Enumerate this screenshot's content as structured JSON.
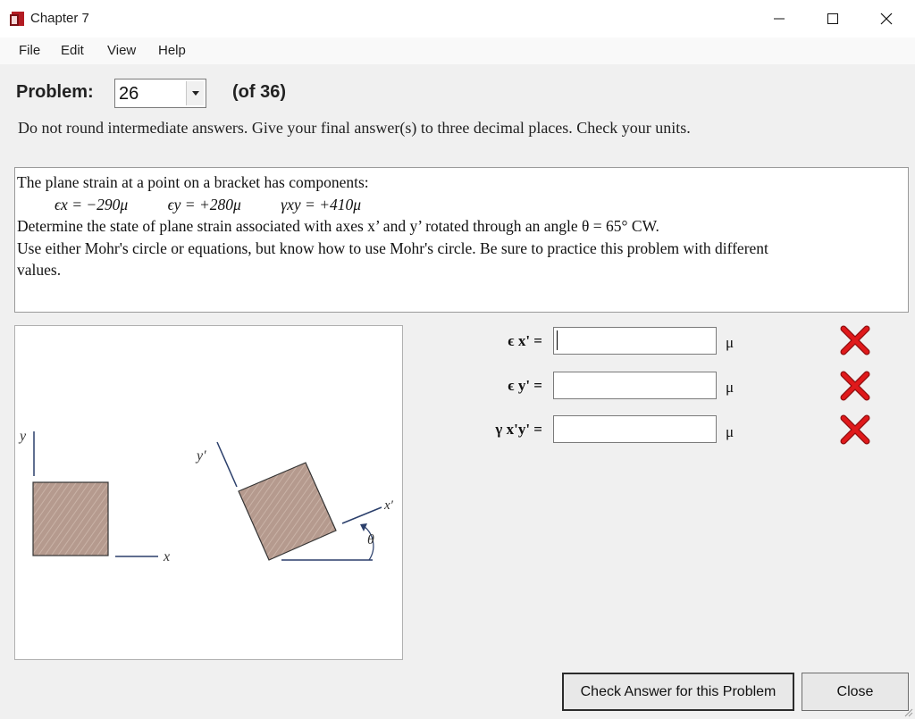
{
  "window": {
    "title": "Chapter 7"
  },
  "menu": {
    "items": [
      "File",
      "Edit",
      "View",
      "Help"
    ]
  },
  "problem": {
    "label": "Problem:",
    "number": "26",
    "total_label": "(of 36)"
  },
  "instructions": "Do not round intermediate answers.  Give your final answer(s) to three decimal places.  Check your units.",
  "statement": {
    "line1": "The plane strain at a point on a bracket has components:",
    "strains": {
      "ex": "ϵx = −290μ",
      "ey": "ϵy = +280μ",
      "gxy": "γxy = +410μ"
    },
    "line3": "Determine the state of plane strain associated with axes x’ and y’ rotated through an angle θ = 65° CW.",
    "line4": "Use either Mohr's circle or equations, but know how to use Mohr's circle.  Be sure to practice this problem with different",
    "line5": "values."
  },
  "figure": {
    "y_label": "y",
    "x_label": "x",
    "y_prime_label": "y′",
    "x_prime_label": "x′",
    "theta_label": "θ"
  },
  "answers": [
    {
      "label": "ϵ x' =",
      "value": "",
      "unit": "μ",
      "status": "incorrect"
    },
    {
      "label": "ϵ y' =",
      "value": "",
      "unit": "μ",
      "status": "incorrect"
    },
    {
      "label": "γ x'y' =",
      "value": "",
      "unit": "μ",
      "status": "incorrect"
    }
  ],
  "buttons": {
    "check": "Check Answer for this Problem",
    "close": "Close"
  },
  "colors": {
    "incorrect": "#e0191b",
    "material": "#b59a8e",
    "axis": "#2b3f6b"
  }
}
